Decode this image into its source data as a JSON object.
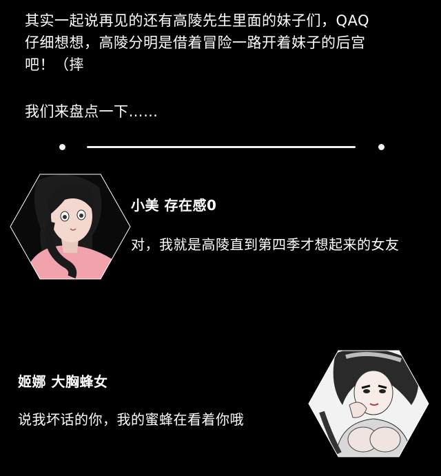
{
  "intro": {
    "lines": [
      "其实一起说再见的还有高陵先生里面的妹子们，QAQ",
      "仔细想想，高陵分明是借着冒险一路开着妹子的后宫",
      "吧！（摔"
    ],
    "closing": "我们来盘点一下……"
  },
  "characters": [
    {
      "name": "小美  存在感0",
      "description": "对，我就是高陵直到第四季才想起来的女友",
      "icon": "avatar-xiaomei"
    },
    {
      "name": "姬娜  大胸蜂女",
      "description": "说我坏话的你，我的蜜蜂在看着你哦",
      "icon": "avatar-jina"
    }
  ],
  "colors": {
    "background": "#000000",
    "text": "#ffffff",
    "divider": "#f2f2f2",
    "skin": "#f3d8cf",
    "shirt": "#f0a3ad"
  }
}
